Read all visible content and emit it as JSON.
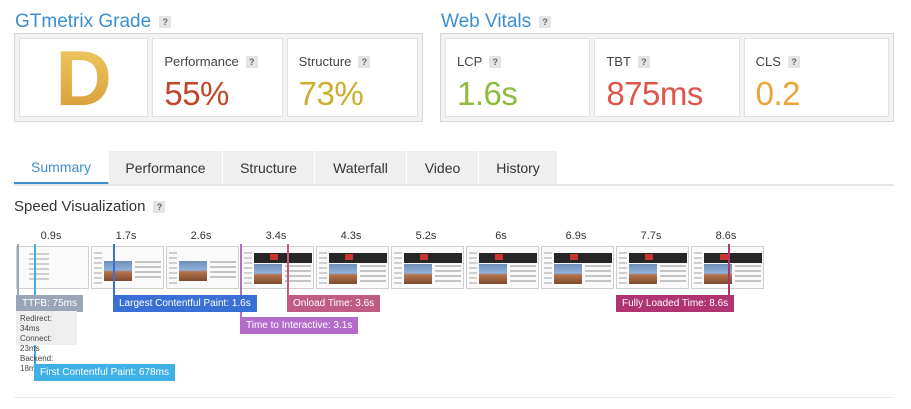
{
  "grade": {
    "title": "GTmetrix Grade",
    "help": "?",
    "letter": "D"
  },
  "performance": {
    "label": "Performance",
    "value": "55%",
    "color": "#c0472a"
  },
  "structure": {
    "label": "Structure",
    "value": "73%",
    "color": "#cdae2e"
  },
  "web_vitals": {
    "title": "Web Vitals",
    "help": "?",
    "lcp": {
      "label": "LCP",
      "value": "1.6s",
      "color": "#8dbb3c"
    },
    "tbt": {
      "label": "TBT",
      "value": "875ms",
      "color": "#e0564c"
    },
    "cls": {
      "label": "CLS",
      "value": "0.2",
      "color": "#eaa43b"
    }
  },
  "tabs": [
    {
      "label": "Summary",
      "active": true
    },
    {
      "label": "Performance",
      "active": false
    },
    {
      "label": "Structure",
      "active": false
    },
    {
      "label": "Waterfall",
      "active": false
    },
    {
      "label": "Video",
      "active": false
    },
    {
      "label": "History",
      "active": false
    }
  ],
  "speed_visualization": {
    "title": "Speed Visualization",
    "help": "?",
    "times": [
      "0.9s",
      "1.7s",
      "2.6s",
      "3.4s",
      "4.3s",
      "5.2s",
      "6s",
      "6.9s",
      "7.7s",
      "8.6s"
    ],
    "markers": {
      "ttfb": {
        "label": "TTFB: 75ms",
        "color": "#9aa6b8"
      },
      "ttfb_detail": {
        "redirect": "Redirect: 34ms",
        "connect": "Connect: 23ms",
        "backend": "Backend: 18ms"
      },
      "fcp": {
        "label": "First Contentful Paint: 678ms",
        "color": "#3fb0e6"
      },
      "lcp": {
        "label": "Largest Contentful Paint: 1.6s",
        "color": "#3a6fd6"
      },
      "tti": {
        "label": "Time to Interactive: 3.1s",
        "color": "#b46ccb"
      },
      "onload": {
        "label": "Onload Time: 3.6s",
        "color": "#c05c84"
      },
      "fully_loaded": {
        "label": "Fully Loaded Time: 8.6s",
        "color": "#b03472"
      }
    }
  }
}
